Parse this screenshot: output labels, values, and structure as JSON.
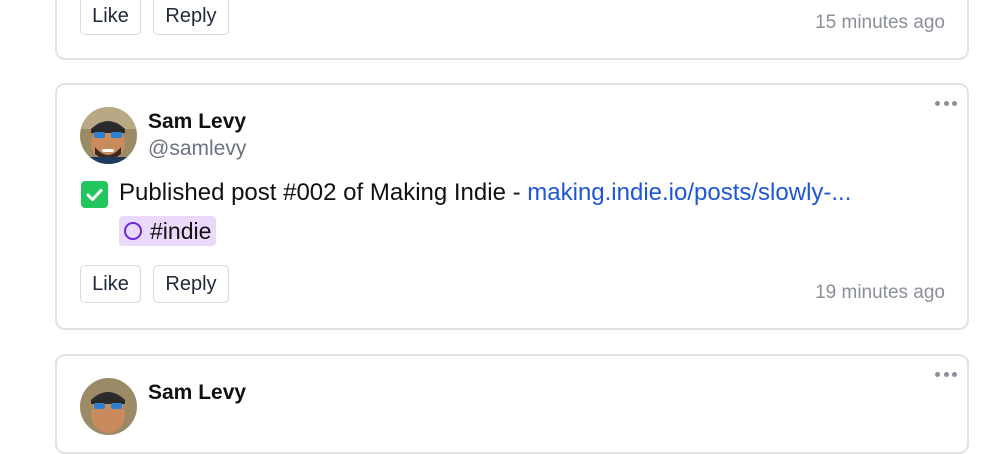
{
  "posts": [
    {
      "actions": {
        "like": "Like",
        "reply": "Reply"
      },
      "timestamp": "15 minutes ago"
    },
    {
      "author": {
        "name": "Sam Levy",
        "handle": "@samlevy",
        "avatar": "avatar-photo"
      },
      "status_icon": "checkmark-icon",
      "text": "Published post #002 of Making Indie - ",
      "link": "making.indie.io/posts/slowly-...",
      "tag": {
        "icon": "circle-icon",
        "label": "#indie",
        "color": "#ead9fb"
      },
      "actions": {
        "like": "Like",
        "reply": "Reply"
      },
      "timestamp": "19 minutes ago"
    },
    {
      "author": {
        "name": "Sam Levy"
      }
    }
  ],
  "colors": {
    "link": "#1d56d6",
    "check": "#22c55e",
    "tag_ring": "#6d28d9",
    "muted": "#8b8f98"
  }
}
